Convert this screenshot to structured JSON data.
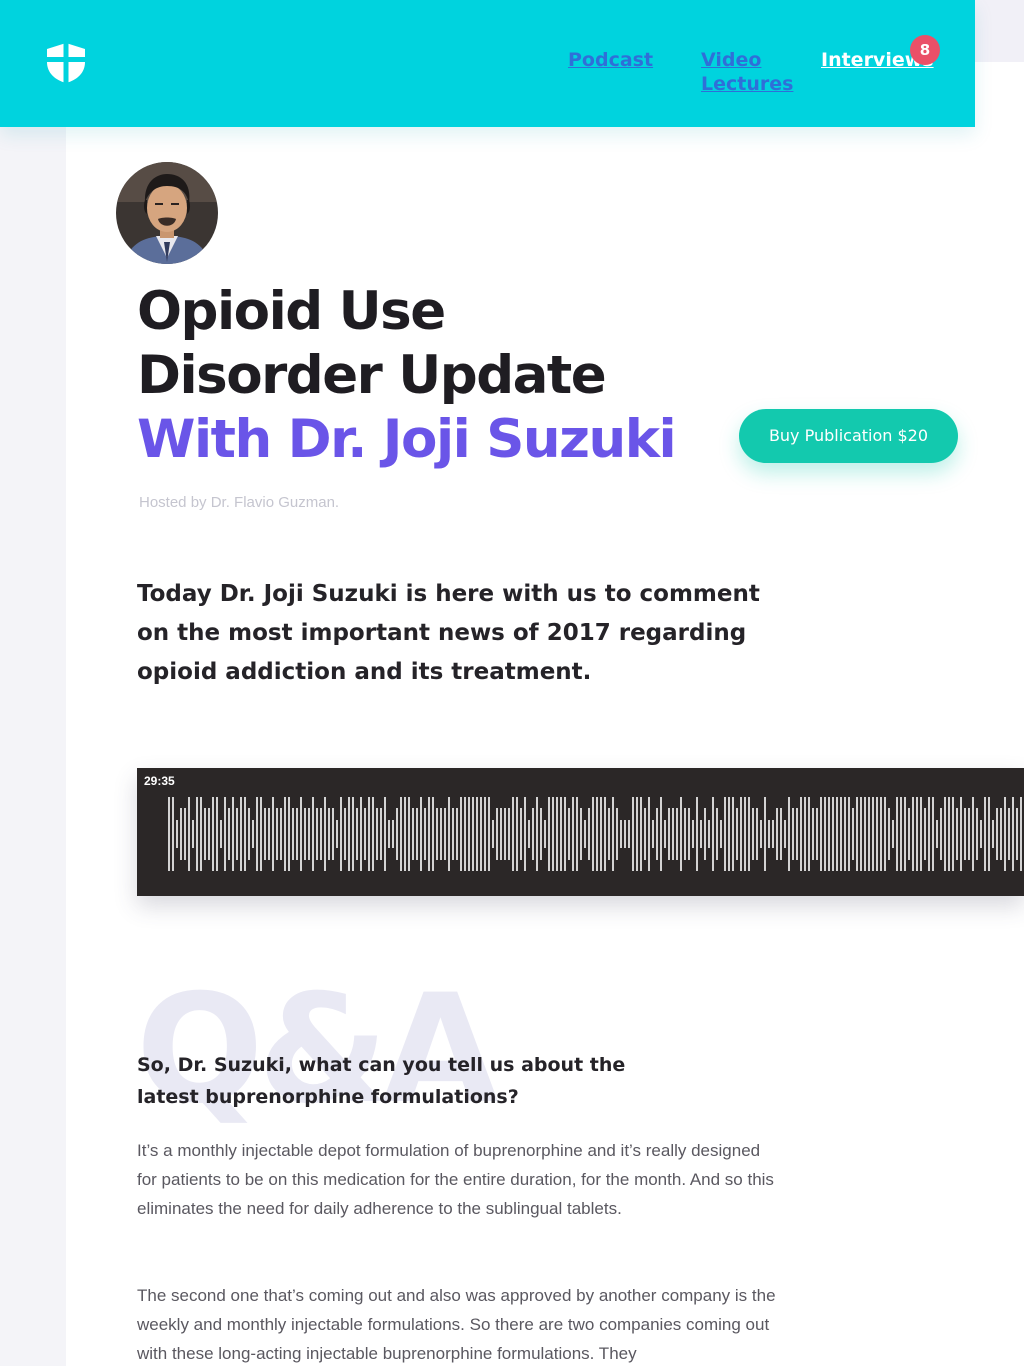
{
  "nav": {
    "podcast": "Podcast",
    "video": "Video Lectures",
    "interviews": "Interviews",
    "interviews_badge": "8"
  },
  "article": {
    "title_line1": "Opioid Use",
    "title_line2": "Disorder Update",
    "title_line3": "With Dr. Joji Suzuki",
    "hosted_by": "Hosted by Dr. Flavio Guzman.",
    "buy_button": "Buy Publication $20",
    "intro": "Today Dr. Joji Suzuki is here with us to comment on the most important news of 2017 regarding opioid addiction and its treatment."
  },
  "player": {
    "duration": "29:35"
  },
  "qa": {
    "watermark": "Q&A",
    "question": "So, Dr. Suzuki, what can you tell us about the latest buprenorphine formulations?",
    "answer_1": "It’s a monthly injectable depot formulation of buprenorphine and it’s really designed for patients to be on this medication for the entire duration, for the month. And so this eliminates the need for daily adherence to the sublingual tablets.",
    "answer_2": "The second one that’s coming out and also was approved by another company is the weekly and monthly injectable formulations. So there are two companies coming out with these long-acting injectable buprenorphine formulations. They"
  },
  "colors": {
    "header": "#00d3de",
    "accent_purple": "#6a55e8",
    "buy_button": "#13c9ae",
    "badge": "#ea5068",
    "player_bg": "#2b2727"
  },
  "icons": {
    "logo": "shield-cross-icon",
    "avatar": "speaker-portrait"
  }
}
